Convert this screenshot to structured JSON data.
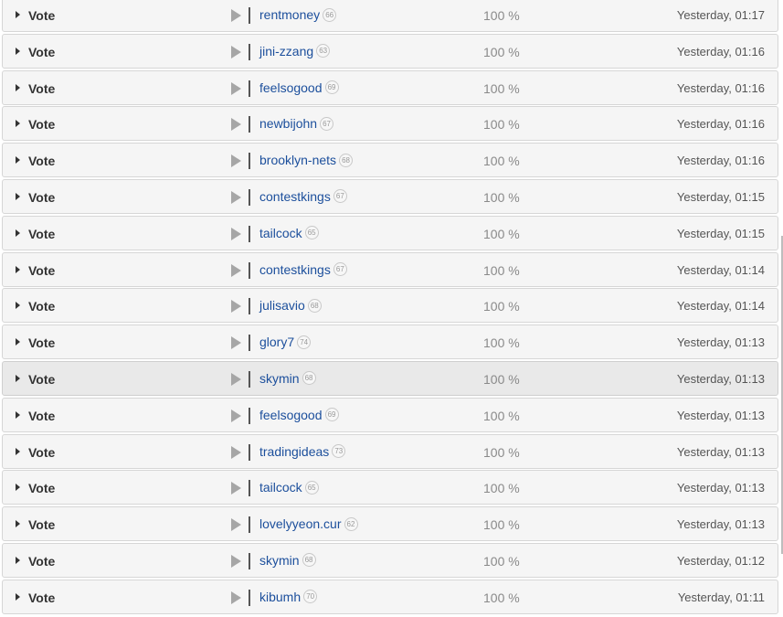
{
  "rows": [
    {
      "action": "Vote",
      "voter": "rentmoney",
      "reputation": "66",
      "weight": "100 %",
      "time": "Yesterday, 01:17"
    },
    {
      "action": "Vote",
      "voter": "jini-zzang",
      "reputation": "63",
      "weight": "100 %",
      "time": "Yesterday, 01:16"
    },
    {
      "action": "Vote",
      "voter": "feelsogood",
      "reputation": "69",
      "weight": "100 %",
      "time": "Yesterday, 01:16"
    },
    {
      "action": "Vote",
      "voter": "newbijohn",
      "reputation": "67",
      "weight": "100 %",
      "time": "Yesterday, 01:16"
    },
    {
      "action": "Vote",
      "voter": "brooklyn-nets",
      "reputation": "68",
      "weight": "100 %",
      "time": "Yesterday, 01:16"
    },
    {
      "action": "Vote",
      "voter": "contestkings",
      "reputation": "67",
      "weight": "100 %",
      "time": "Yesterday, 01:15"
    },
    {
      "action": "Vote",
      "voter": "tailcock",
      "reputation": "65",
      "weight": "100 %",
      "time": "Yesterday, 01:15"
    },
    {
      "action": "Vote",
      "voter": "contestkings",
      "reputation": "67",
      "weight": "100 %",
      "time": "Yesterday, 01:14"
    },
    {
      "action": "Vote",
      "voter": "julisavio",
      "reputation": "68",
      "weight": "100 %",
      "time": "Yesterday, 01:14"
    },
    {
      "action": "Vote",
      "voter": "glory7",
      "reputation": "74",
      "weight": "100 %",
      "time": "Yesterday, 01:13"
    },
    {
      "action": "Vote",
      "voter": "skymin",
      "reputation": "68",
      "weight": "100 %",
      "time": "Yesterday, 01:13",
      "highlighted": true
    },
    {
      "action": "Vote",
      "voter": "feelsogood",
      "reputation": "69",
      "weight": "100 %",
      "time": "Yesterday, 01:13"
    },
    {
      "action": "Vote",
      "voter": "tradingideas",
      "reputation": "73",
      "weight": "100 %",
      "time": "Yesterday, 01:13"
    },
    {
      "action": "Vote",
      "voter": "tailcock",
      "reputation": "65",
      "weight": "100 %",
      "time": "Yesterday, 01:13"
    },
    {
      "action": "Vote",
      "voter": "lovelyyeon.cur",
      "reputation": "62",
      "weight": "100 %",
      "time": "Yesterday, 01:13"
    },
    {
      "action": "Vote",
      "voter": "skymin",
      "reputation": "68",
      "weight": "100 %",
      "time": "Yesterday, 01:12"
    },
    {
      "action": "Vote",
      "voter": "kibumh",
      "reputation": "70",
      "weight": "100 %",
      "time": "Yesterday, 01:11"
    }
  ],
  "icons": {
    "expand": "caret-right-icon",
    "play": "play-icon"
  },
  "colors": {
    "link": "#1c4f9c",
    "row_background": "#f5f5f5",
    "row_highlight": "#e9e9e9",
    "play_icon": "#a6a6a6"
  }
}
